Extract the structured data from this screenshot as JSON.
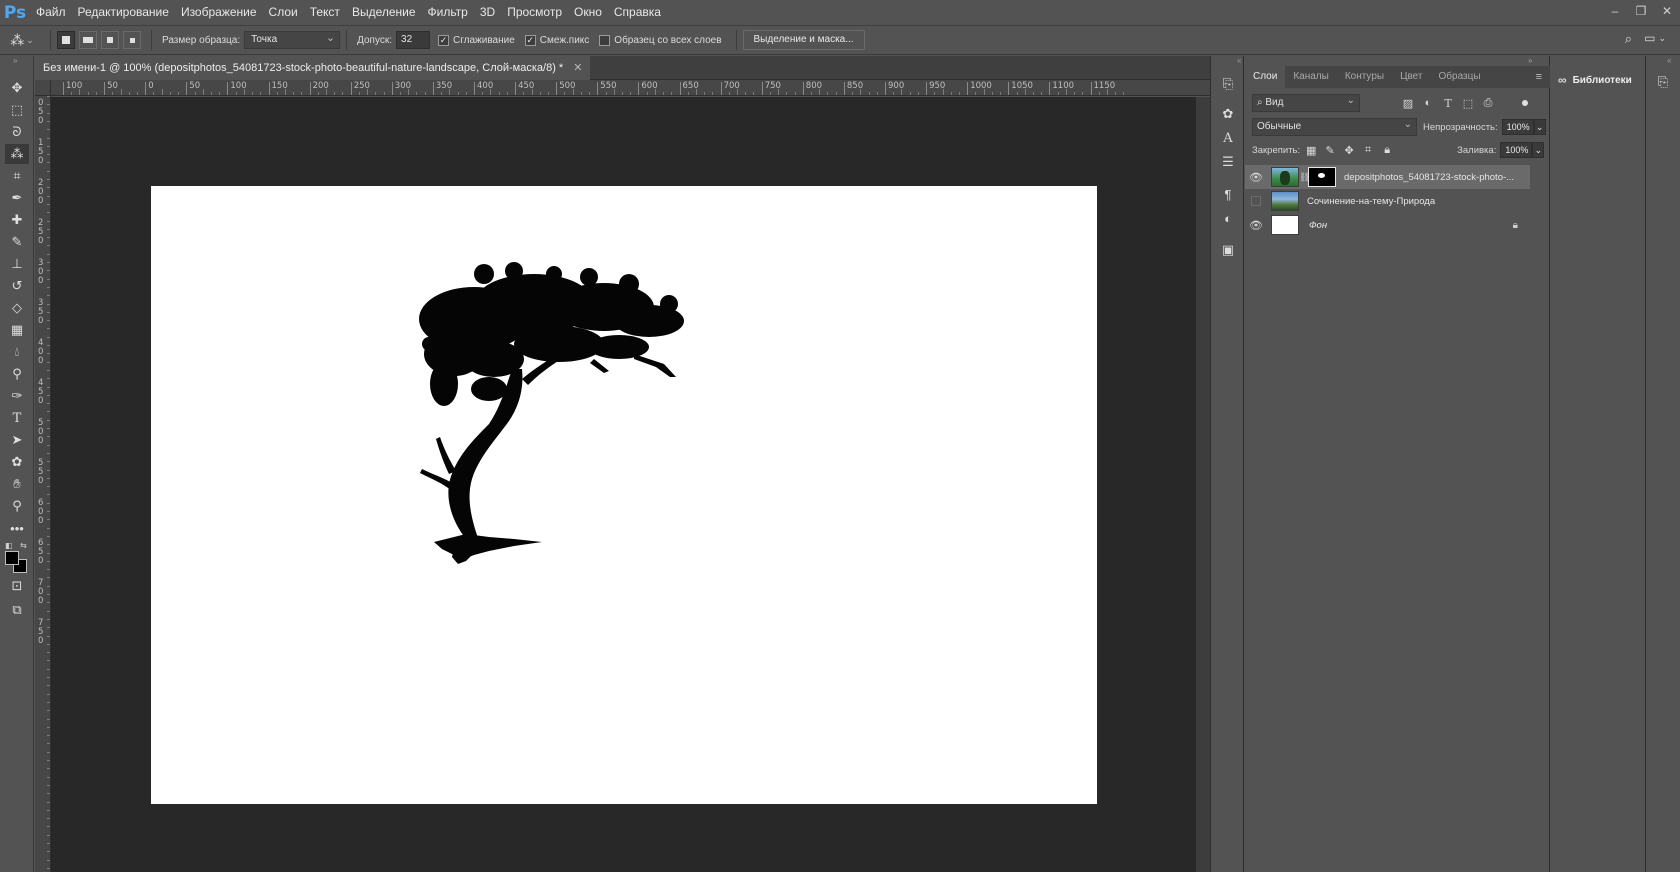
{
  "app": {
    "logo": "Ps"
  },
  "menu": [
    "Файл",
    "Редактирование",
    "Изображение",
    "Слои",
    "Текст",
    "Выделение",
    "Фильтр",
    "3D",
    "Просмотр",
    "Окно",
    "Справка"
  ],
  "options": {
    "sample_size_label": "Размер образца:",
    "sample_size_value": "Точка",
    "tolerance_label": "Допуск:",
    "tolerance_value": "32",
    "anti_alias_label": "Сглаживание",
    "contiguous_label": "Смеж.пикс",
    "all_layers_label": "Образец со всех слоев",
    "select_mask_button": "Выделение и маска..."
  },
  "document": {
    "tab_title": "Без имени-1 @ 100% (depositphotos_54081723-stock-photo-beautiful-nature-landscape, Слой-маска/8) *",
    "ruler_h_labels": [
      "100",
      "50",
      "0",
      "50",
      "100",
      "150",
      "200",
      "250",
      "300",
      "350",
      "400",
      "450",
      "500",
      "550",
      "600",
      "650",
      "700",
      "750",
      "800",
      "850",
      "900",
      "950",
      "1000",
      "1050",
      "1100",
      "1150"
    ],
    "ruler_v_labels": [
      "0",
      "5",
      "0",
      "1",
      "5",
      "0",
      "2",
      "0",
      "0",
      "2",
      "5",
      "0",
      "3",
      "0",
      "0",
      "3",
      "5",
      "0",
      "4",
      "0",
      "0",
      "4",
      "5",
      "0",
      "5",
      "0",
      "0",
      "5",
      "5",
      "0",
      "6",
      "0",
      "0",
      "6",
      "5",
      "0",
      "7",
      "0",
      "0",
      "7",
      "5",
      "0"
    ]
  },
  "layers_panel": {
    "tabs": [
      "Слои",
      "Каналы",
      "Контуры",
      "Цвет",
      "Образцы"
    ],
    "active_tab": "Слои",
    "filter_label": "Вид",
    "blend_mode": "Обычные",
    "opacity_label": "Непрозрачность:",
    "opacity_value": "100%",
    "lock_label": "Закрепить:",
    "fill_label": "Заливка:",
    "fill_value": "100%",
    "layers": [
      {
        "name": "depositphotos_54081723-stock-photo-...",
        "visible": true,
        "selected": true,
        "has_mask": true
      },
      {
        "name": "Сочинение-на-тему-Природа",
        "visible": false,
        "selected": false,
        "has_mask": false
      },
      {
        "name": "Фон",
        "visible": true,
        "selected": false,
        "locked": true
      }
    ]
  },
  "libraries_panel": {
    "title": "Библиотеки"
  },
  "colors": {
    "ui_bg": "#535353",
    "pasteboard": "#282828",
    "canvas": "#ffffff",
    "selection": "#6a6a6a",
    "ps_blue": "#4fa8f0"
  }
}
